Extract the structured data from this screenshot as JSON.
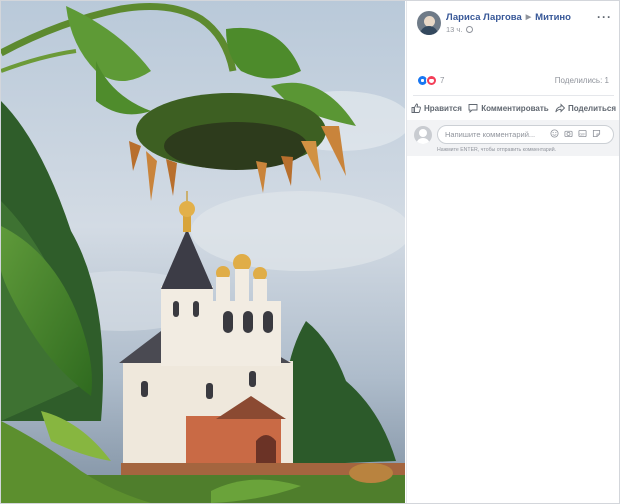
{
  "post": {
    "author": "Лариса Ларгова",
    "location": "Митино",
    "time": "13 ч.",
    "more_label": "···"
  },
  "reactions": {
    "count": "7",
    "shares": "Поделились: 1"
  },
  "actions": {
    "like": "Нравится",
    "comment": "Комментировать",
    "share": "Поделиться"
  },
  "comment_box": {
    "placeholder": "Напишите комментарий...",
    "hint": "Нажмите ENTER, чтобы отправить комментарий."
  },
  "colors": {
    "link": "#385898",
    "muted": "#90949c",
    "like": "#1877f2",
    "love": "#f33e58"
  }
}
